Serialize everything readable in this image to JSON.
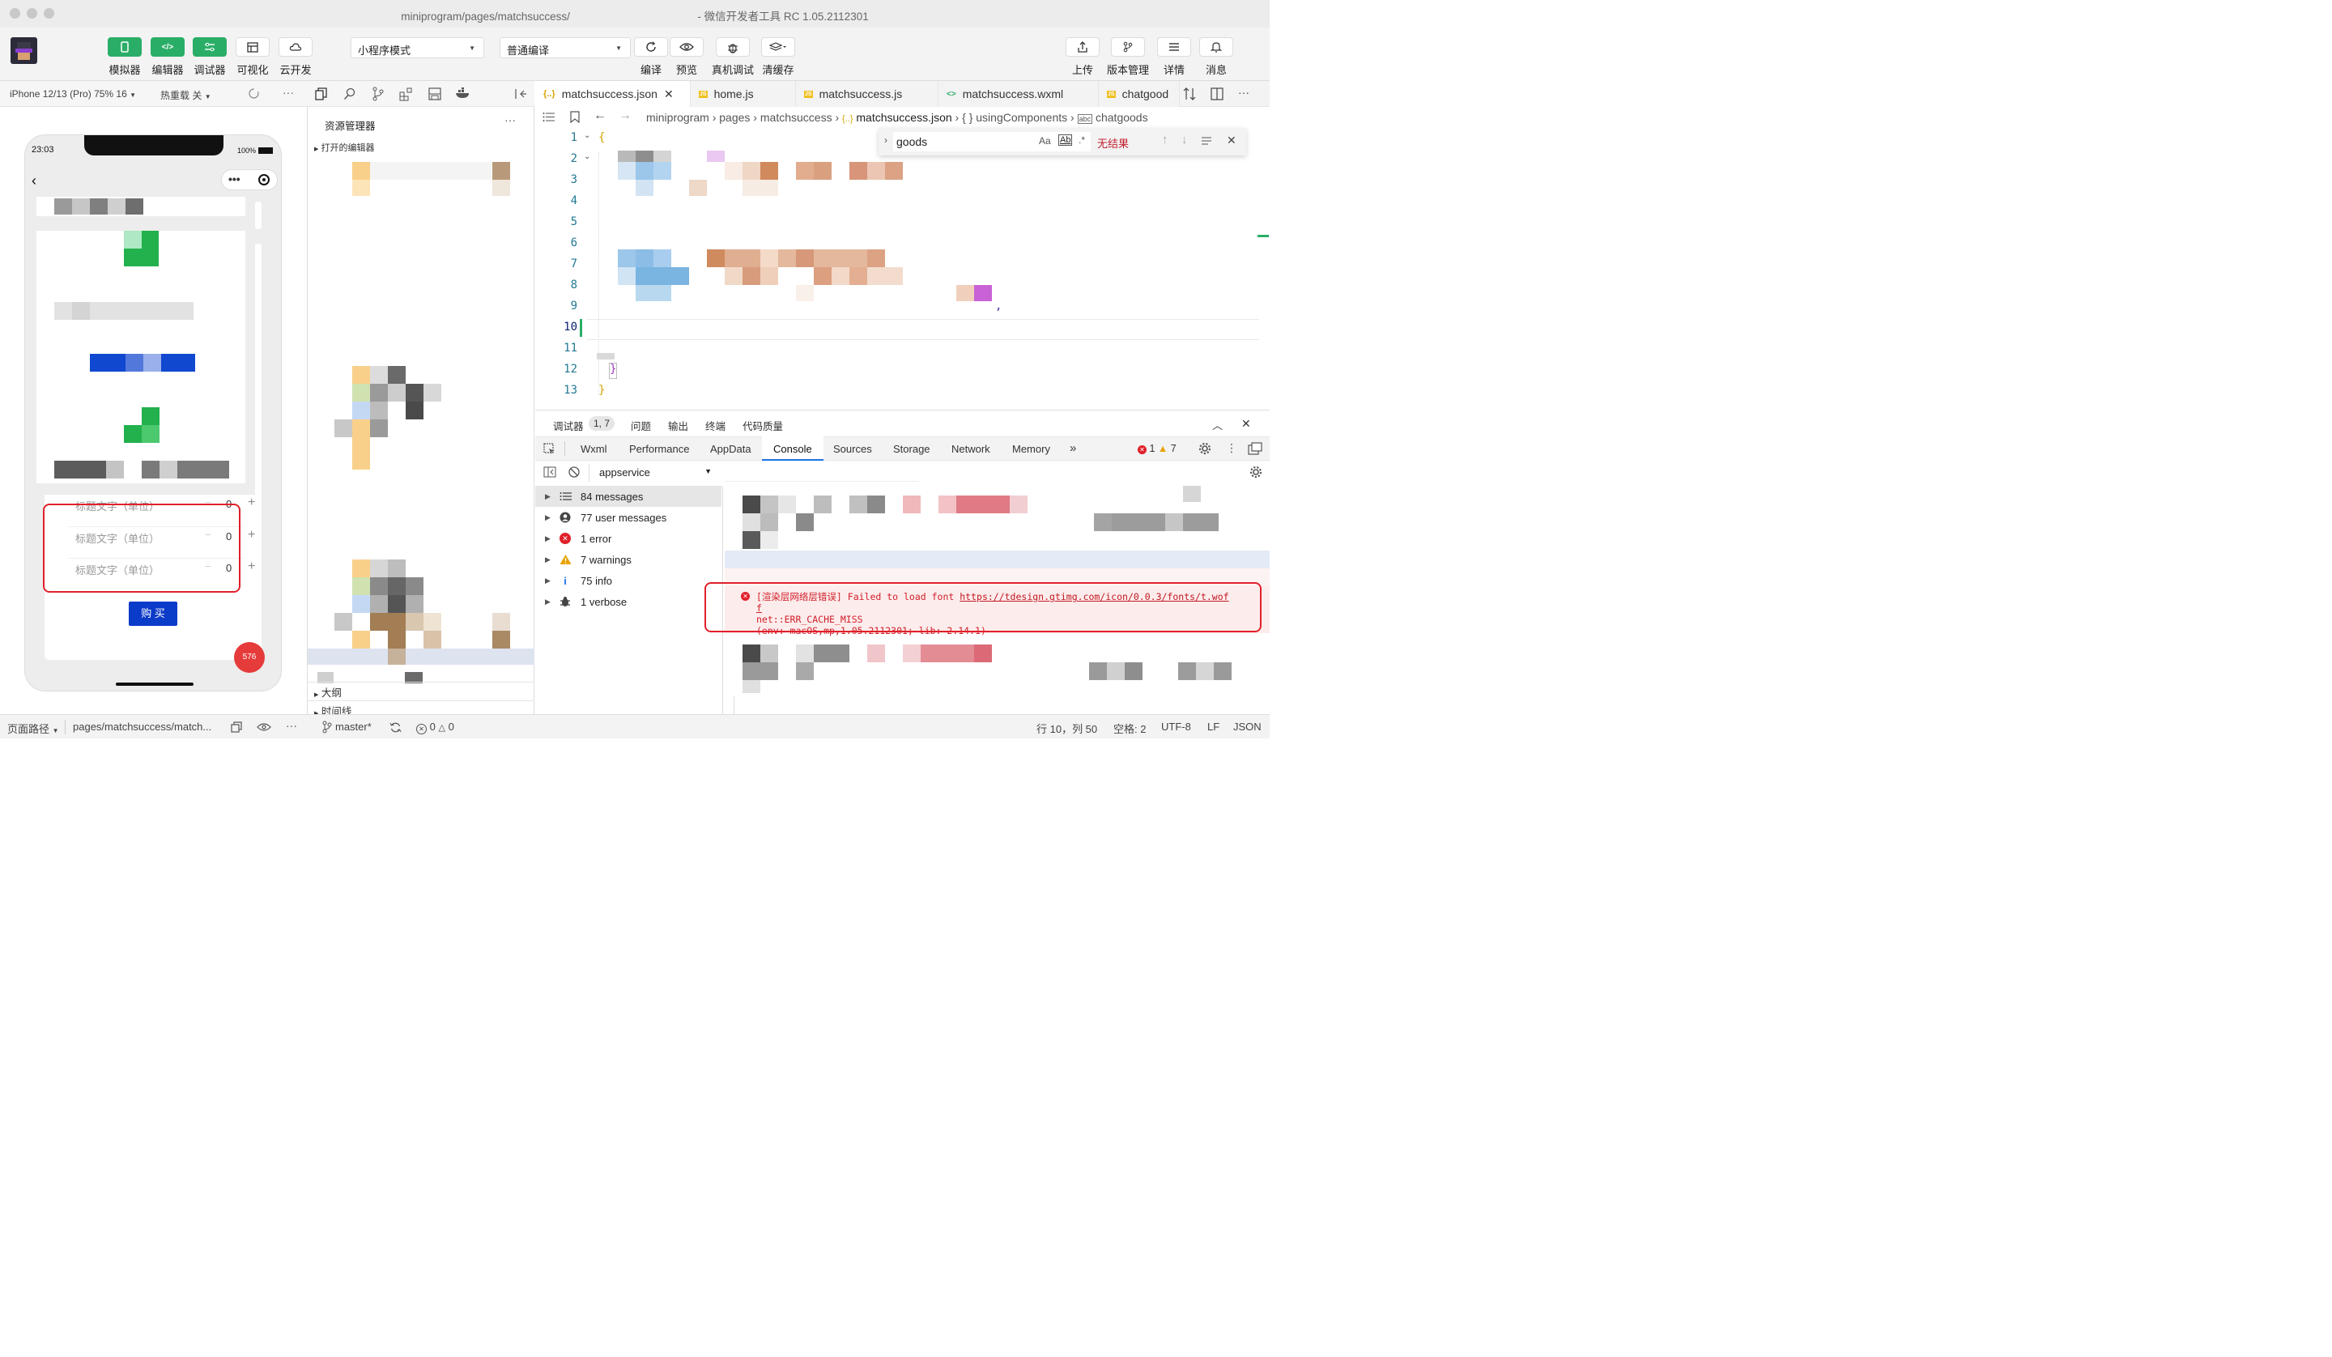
{
  "window": {
    "title_path": "miniprogram/pages/matchsuccess/",
    "title_app": "- 微信开发者工具 RC 1.05.2112301"
  },
  "toolbar": {
    "simulator": "模拟器",
    "editor": "编辑器",
    "debugger": "调试器",
    "visual": "可视化",
    "cloud": "云开发",
    "mode_select": "小程序模式",
    "compile_select": "普通编译",
    "compile": "编译",
    "preview": "预览",
    "real_debug": "真机调试",
    "clear_cache": "清缓存",
    "upload": "上传",
    "version": "版本管理",
    "details": "详情",
    "messages": "消息"
  },
  "simulator": {
    "device": "iPhone 12/13 (Pro) 75% 16",
    "hot_reload": "热重载 关",
    "time": "23:03",
    "battery": "100%",
    "rows": [
      {
        "label": "标题文字（单位）",
        "value": "0"
      },
      {
        "label": "标题文字（单位）",
        "value": "0"
      },
      {
        "label": "标题文字（单位）",
        "value": "0"
      }
    ],
    "buy_label": "购 买",
    "badge": "576"
  },
  "explorer": {
    "title": "资源管理器",
    "open_editors": "打开的编辑器",
    "outline": "大纲",
    "timeline": "时间线"
  },
  "editor": {
    "tabs": [
      {
        "icon": "{..}",
        "label": "matchsuccess.json"
      },
      {
        "icon": "JS",
        "label": "home.js"
      },
      {
        "icon": "JS",
        "label": "matchsuccess.js"
      },
      {
        "icon": "<>",
        "label": "matchsuccess.wxml"
      },
      {
        "icon": "JS",
        "label": "chatgood"
      }
    ],
    "breadcrumb": [
      "miniprogram",
      "pages",
      "matchsuccess",
      "matchsuccess.json",
      "usingComponents",
      "chatgoods"
    ],
    "find_query": "goods",
    "find_result": "无结果",
    "line_numbers": [
      "1",
      "2",
      "3",
      "4",
      "5",
      "6",
      "7",
      "8",
      "9",
      "10",
      "11",
      "12",
      "13"
    ],
    "current_line": "10"
  },
  "debugger": {
    "panel_tabs": [
      "调试器",
      "问题",
      "输出",
      "终端",
      "代码质量"
    ],
    "position_badge": "1, 7",
    "devtools_tabs": [
      "Wxml",
      "Performance",
      "AppData",
      "Console",
      "Sources",
      "Storage",
      "Network",
      "Memory"
    ],
    "more": "»",
    "error_count": "1",
    "warning_count": "7",
    "context": "appservice",
    "sidebar": [
      {
        "icon": "list-icon",
        "label": "84 messages"
      },
      {
        "icon": "user-icon",
        "label": "77 user messages"
      },
      {
        "icon": "error-icon",
        "label": "1 error"
      },
      {
        "icon": "warning-icon",
        "label": "7 warnings"
      },
      {
        "icon": "info-icon",
        "label": "75 info"
      },
      {
        "icon": "bug-icon",
        "label": "1 verbose"
      }
    ],
    "error_message": {
      "prefix": "[渲染层网络层错误] Failed to load font ",
      "url": "https://tdesign.gtimg.com/icon/0.0.3/fonts/t.wof",
      "url_cont": "f",
      "line2": "net::ERR_CACHE_MISS",
      "line3": "(env: macOS,mp,1.05.2112301; lib: 2.14.1)"
    }
  },
  "status": {
    "page_path_label": "页面路径",
    "page_path": "pages/matchsuccess/match...",
    "branch": "master*",
    "errors": "0",
    "warnings": "0",
    "position": "行 10，列 50",
    "indent": "空格: 2",
    "encoding": "UTF-8",
    "eol": "LF",
    "language": "JSON"
  },
  "colors": {
    "green": "#2aae67",
    "buy_button": "#0b3bc9",
    "badge": "#e53b3b",
    "error_highlight": "#e0202a",
    "error_bg": "#fdecec"
  }
}
